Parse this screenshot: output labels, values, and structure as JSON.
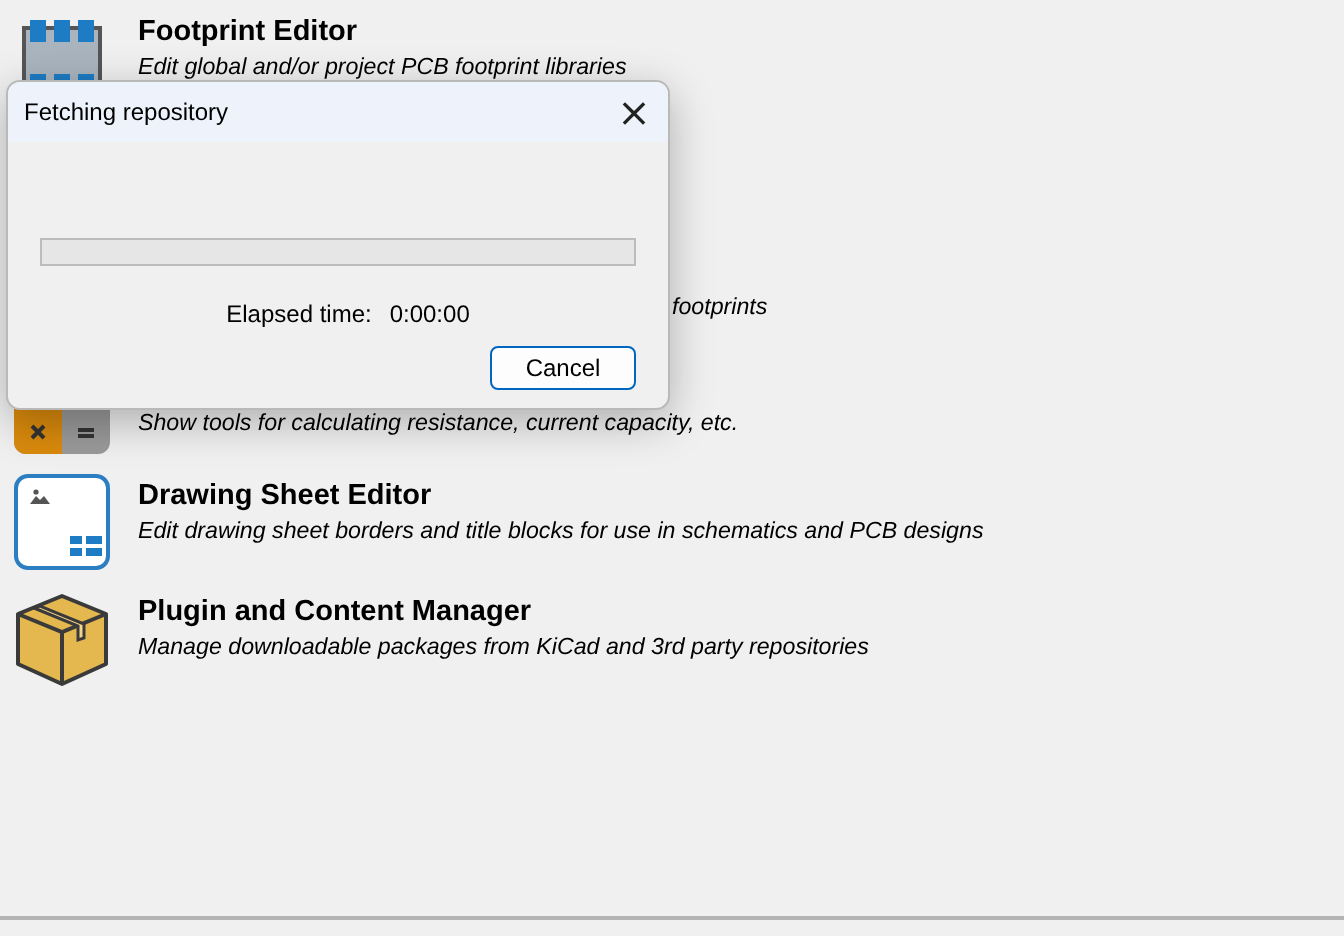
{
  "launcher": {
    "items": [
      {
        "kind": "footprint",
        "title": "Footprint Editor",
        "description": "Edit global and/or project PCB footprint libraries"
      },
      {
        "kind": "hidden"
      },
      {
        "kind": "clipped",
        "description": "footprints"
      },
      {
        "kind": "calculator",
        "description": "Show tools for calculating resistance, current capacity, etc."
      },
      {
        "kind": "sheet",
        "title": "Drawing Sheet Editor",
        "description": "Edit drawing sheet borders and title blocks for use in schematics and PCB designs"
      },
      {
        "kind": "package",
        "title": "Plugin and Content Manager",
        "description": "Manage downloadable packages from KiCad and 3rd party repositories"
      }
    ]
  },
  "dialog": {
    "title": "Fetching repository",
    "close": "×",
    "progress": {
      "level": 0
    },
    "elapsed_label": "Elapsed time:",
    "elapsed_value": "0:00:00",
    "buttons": [
      "Cancel"
    ]
  }
}
